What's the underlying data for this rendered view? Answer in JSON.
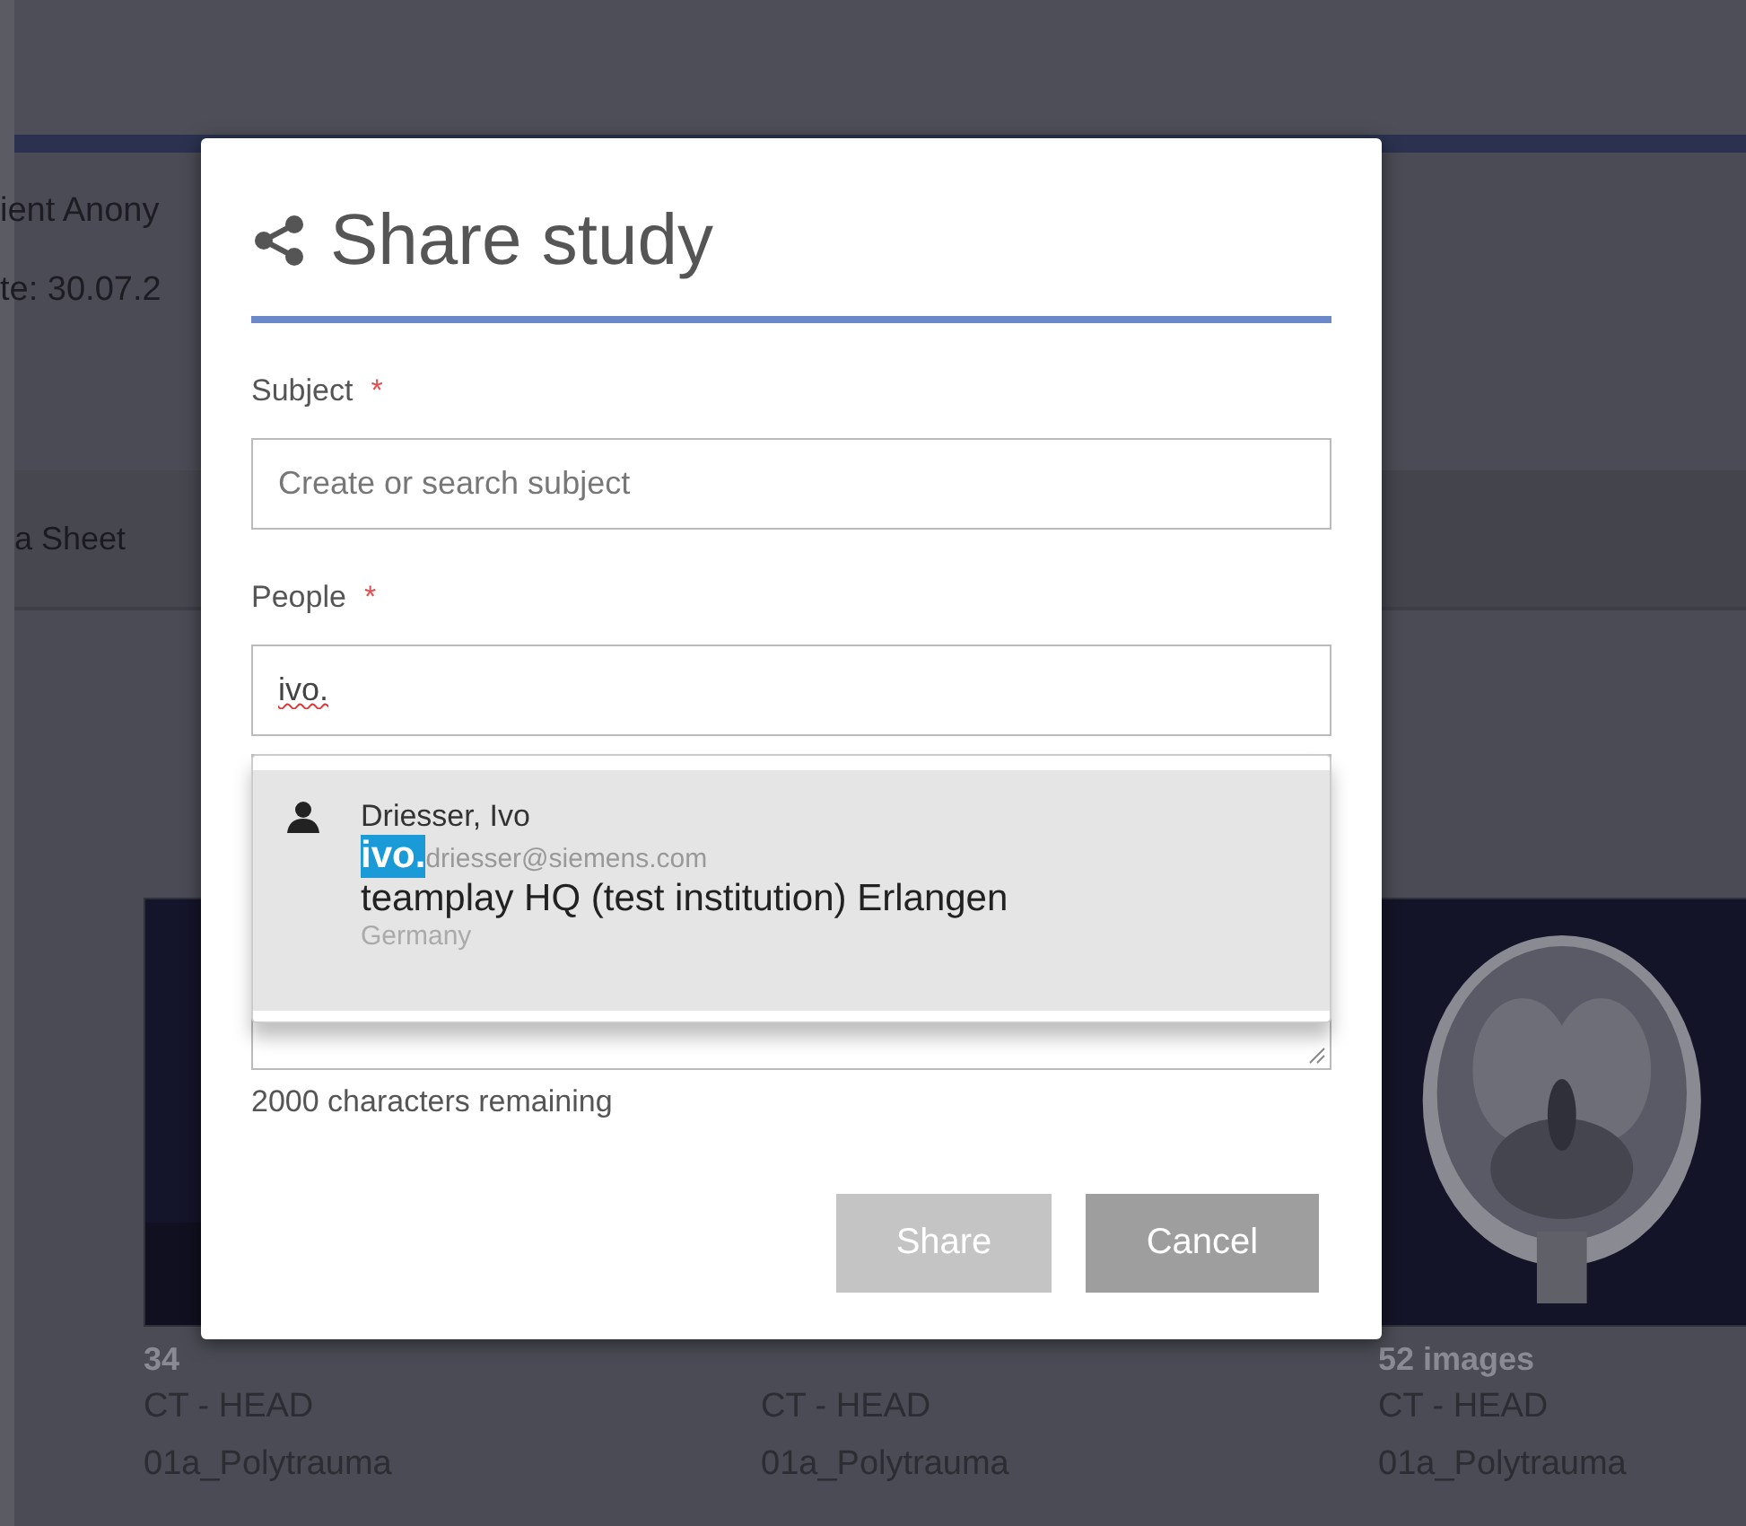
{
  "page": {
    "patient_line": "ient Anony",
    "date_line": "te: 30.07.2",
    "tab": "a Sheet",
    "series": [
      {
        "kind": "picture",
        "count": "34",
        "modality": "CT - HEAD",
        "protocol": "01a_Polytrauma"
      },
      {
        "modality": "CT - HEAD",
        "protocol": "01a_Polytrauma"
      },
      {
        "kind": "picture",
        "count": "52 images",
        "modality": "CT - HEAD",
        "protocol": "01a_Polytrauma"
      }
    ]
  },
  "dialog": {
    "title": "Share study",
    "subject": {
      "label": "Subject",
      "required": true,
      "required_mark": "*",
      "placeholder": "Create or search subject"
    },
    "people": {
      "label": "People",
      "required": true,
      "required_mark": "*",
      "value": "ivo."
    },
    "suggestions": [
      {
        "name": "Driesser, Ivo",
        "email_match": "ivo.",
        "email_rest": "driesser@siemens.com",
        "institution": "teamplay HQ (test institution) Erlangen",
        "country": "Germany",
        "selected": true
      }
    ],
    "counter": "2000 characters remaining",
    "buttons": [
      {
        "label": "Share",
        "disabled": true
      },
      {
        "label": "Cancel",
        "disabled": false
      }
    ]
  }
}
